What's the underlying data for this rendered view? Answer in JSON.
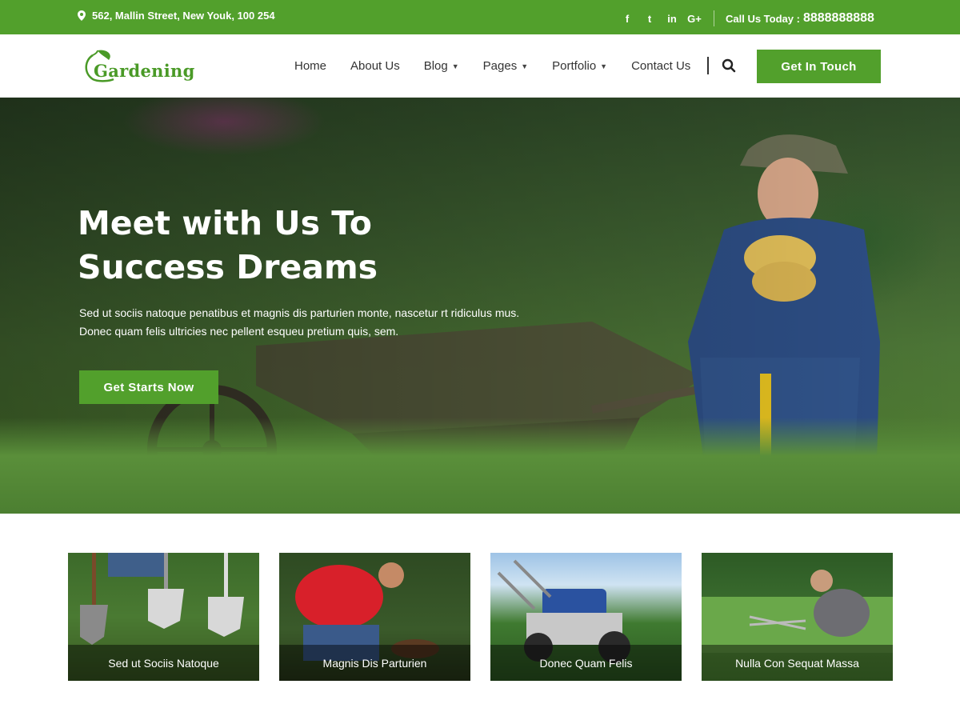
{
  "topbar": {
    "address": "562, Mallin Street, New Youk, 100 254",
    "social": [
      {
        "icon": "facebook-icon",
        "glyph": "f"
      },
      {
        "icon": "twitter-icon",
        "glyph": "t"
      },
      {
        "icon": "linkedin-icon",
        "glyph": "in"
      },
      {
        "icon": "google-plus-icon",
        "glyph": "G+"
      }
    ],
    "call_label": "Call Us Today :",
    "call_number": "8888888888"
  },
  "header": {
    "logo_text": "Gardening",
    "nav": [
      {
        "label": "Home",
        "dropdown": false
      },
      {
        "label": "About Us",
        "dropdown": false
      },
      {
        "label": "Blog",
        "dropdown": true
      },
      {
        "label": "Pages",
        "dropdown": true
      },
      {
        "label": "Portfolio",
        "dropdown": true
      },
      {
        "label": "Contact Us",
        "dropdown": false
      }
    ],
    "cta_label": "Get In Touch"
  },
  "hero": {
    "title": "Meet with Us To Success Dreams",
    "text_line1": "Sed ut sociis natoque penatibus et magnis dis parturien monte, nascetur rt ridiculus mus.",
    "text_line2": "Donec quam felis ultricies nec pellent esqueu pretium quis, sem.",
    "button_label": "Get Starts Now"
  },
  "cards": [
    {
      "caption": "Sed ut Sociis Natoque"
    },
    {
      "caption": "Magnis Dis Parturien"
    },
    {
      "caption": "Donec Quam Felis"
    },
    {
      "caption": "Nulla Con Sequat Massa"
    }
  ],
  "colors": {
    "brand_green": "#52a02c",
    "text_dark": "#333333",
    "white": "#ffffff"
  }
}
